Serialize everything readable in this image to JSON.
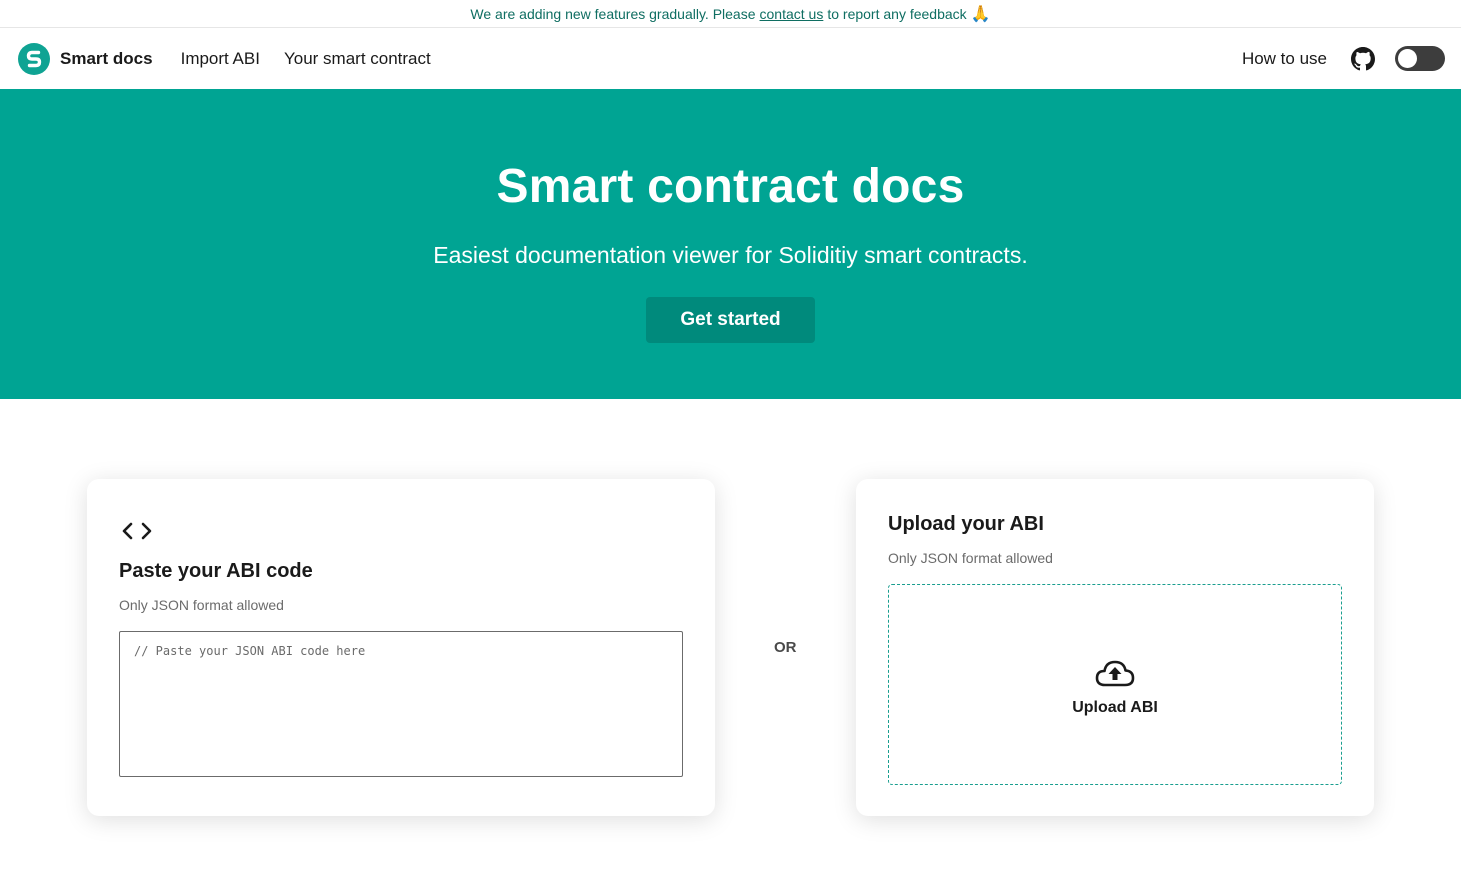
{
  "banner": {
    "text_before": "We are adding new features gradually. Please",
    "link": "contact us",
    "text_after": "to report any feedback",
    "emoji": "🙏"
  },
  "nav": {
    "brand": "Smart docs",
    "links": [
      "Import ABI",
      "Your smart contract"
    ],
    "how_to": "How to use",
    "github_icon": "github-icon",
    "theme_toggle": "off"
  },
  "hero": {
    "title": "Smart contract docs",
    "subtitle": "Easiest documentation viewer for Soliditiy smart contracts.",
    "cta": "Get started"
  },
  "paste_card": {
    "icon": "code-brackets-icon",
    "title": "Paste your ABI code",
    "subtitle": "Only JSON format allowed",
    "placeholder": "// Paste your JSON ABI code here"
  },
  "separator": "OR",
  "upload_card": {
    "title": "Upload your ABI",
    "subtitle": "Only JSON format allowed",
    "icon": "cloud-upload-icon",
    "button_label": "Upload ABI"
  },
  "colors": {
    "brand": "#00a493",
    "cta_bg": "#008a7c",
    "banner_text": "#0f6e62"
  }
}
